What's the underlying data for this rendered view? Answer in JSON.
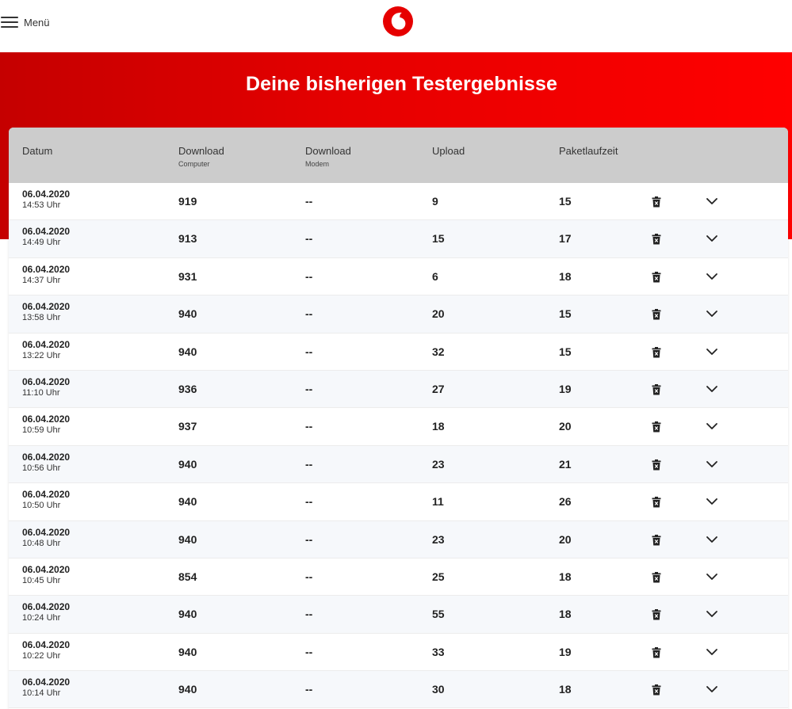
{
  "header": {
    "menu_label": "Menü"
  },
  "hero": {
    "title": "Deine bisherigen Testergebnisse"
  },
  "table": {
    "columns": {
      "date": "Datum",
      "download_computer": "Download",
      "download_computer_sub": "Computer",
      "download_modem": "Download",
      "download_modem_sub": "Modem",
      "upload": "Upload",
      "latency": "Paketlaufzeit"
    },
    "rows": [
      {
        "date": "06.04.2020",
        "time": "14:53 Uhr",
        "dl_computer": "919",
        "dl_modem": "--",
        "upload": "9",
        "latency": "15"
      },
      {
        "date": "06.04.2020",
        "time": "14:49 Uhr",
        "dl_computer": "913",
        "dl_modem": "--",
        "upload": "15",
        "latency": "17"
      },
      {
        "date": "06.04.2020",
        "time": "14:37 Uhr",
        "dl_computer": "931",
        "dl_modem": "--",
        "upload": "6",
        "latency": "18"
      },
      {
        "date": "06.04.2020",
        "time": "13:58 Uhr",
        "dl_computer": "940",
        "dl_modem": "--",
        "upload": "20",
        "latency": "15"
      },
      {
        "date": "06.04.2020",
        "time": "13:22 Uhr",
        "dl_computer": "940",
        "dl_modem": "--",
        "upload": "32",
        "latency": "15"
      },
      {
        "date": "06.04.2020",
        "time": "11:10 Uhr",
        "dl_computer": "936",
        "dl_modem": "--",
        "upload": "27",
        "latency": "19"
      },
      {
        "date": "06.04.2020",
        "time": "10:59 Uhr",
        "dl_computer": "937",
        "dl_modem": "--",
        "upload": "18",
        "latency": "20"
      },
      {
        "date": "06.04.2020",
        "time": "10:56 Uhr",
        "dl_computer": "940",
        "dl_modem": "--",
        "upload": "23",
        "latency": "21"
      },
      {
        "date": "06.04.2020",
        "time": "10:50 Uhr",
        "dl_computer": "940",
        "dl_modem": "--",
        "upload": "11",
        "latency": "26"
      },
      {
        "date": "06.04.2020",
        "time": "10:48 Uhr",
        "dl_computer": "940",
        "dl_modem": "--",
        "upload": "23",
        "latency": "20"
      },
      {
        "date": "06.04.2020",
        "time": "10:45 Uhr",
        "dl_computer": "854",
        "dl_modem": "--",
        "upload": "25",
        "latency": "18"
      },
      {
        "date": "06.04.2020",
        "time": "10:24 Uhr",
        "dl_computer": "940",
        "dl_modem": "--",
        "upload": "55",
        "latency": "18"
      },
      {
        "date": "06.04.2020",
        "time": "10:22 Uhr",
        "dl_computer": "940",
        "dl_modem": "--",
        "upload": "33",
        "latency": "19"
      },
      {
        "date": "06.04.2020",
        "time": "10:14 Uhr",
        "dl_computer": "940",
        "dl_modem": "--",
        "upload": "30",
        "latency": "18"
      }
    ]
  },
  "icons": {
    "menu": "hamburger-menu-icon",
    "logo": "vodafone-logo-icon",
    "delete": "trash-icon",
    "expand": "chevron-down-icon"
  },
  "colors": {
    "brand_red": "#e60000",
    "header_row": "#cccccc",
    "row_alt": "#f6f8fb"
  }
}
